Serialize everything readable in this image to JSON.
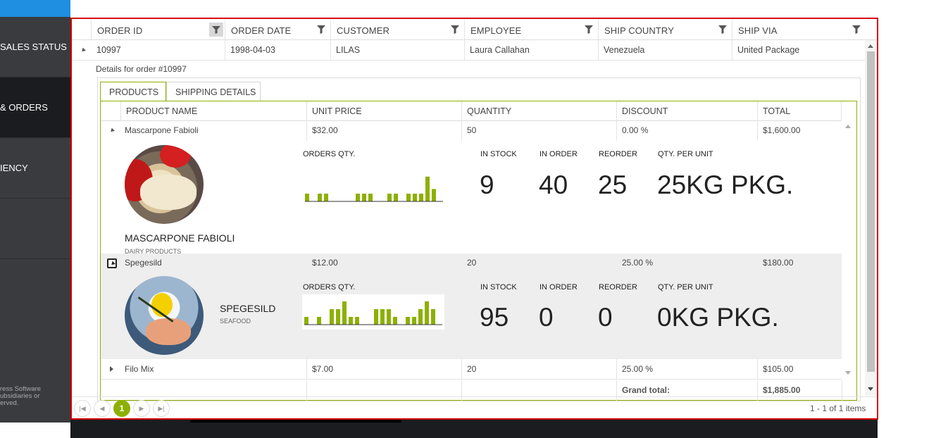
{
  "sidebar": {
    "items": [
      {
        "label": "SALES STATUS"
      },
      {
        "label": "& ORDERS"
      },
      {
        "label": "IENCY"
      }
    ],
    "footer": [
      "ress Software",
      "ubsidiaries or",
      "erved."
    ]
  },
  "grid": {
    "columns": [
      {
        "label": "ORDER ID"
      },
      {
        "label": "ORDER DATE"
      },
      {
        "label": "CUSTOMER"
      },
      {
        "label": "EMPLOYEE"
      },
      {
        "label": "SHIP COUNTRY"
      },
      {
        "label": "SHIP VIA"
      }
    ],
    "row": {
      "order_id": "10997",
      "order_date": "1998-04-03",
      "customer": "LILAS",
      "employee": "Laura Callahan",
      "ship_country": "Venezuela",
      "ship_via": "United Package"
    },
    "details_title": "Details for order #10997"
  },
  "detail": {
    "tabs": [
      {
        "label": "PRODUCTS"
      },
      {
        "label": "SHIPPING DETAILS"
      }
    ],
    "columns": [
      {
        "label": "PRODUCT NAME"
      },
      {
        "label": "UNIT PRICE"
      },
      {
        "label": "QUANTITY"
      },
      {
        "label": "DISCOUNT"
      },
      {
        "label": "TOTAL"
      }
    ],
    "stat_labels": {
      "orders_qty": "ORDERS QTY.",
      "in_stock": "IN STOCK",
      "in_order": "IN ORDER",
      "reorder": "REORDER",
      "qty_per_unit": "QTY. PER UNIT"
    },
    "products": [
      {
        "name": "Mascarpone Fabioli",
        "price": "$32.00",
        "quantity": "50",
        "discount": "0.00 %",
        "total": "$1,600.00",
        "title": "MASCARPONE FABIOLI",
        "category": "DAIRY PRODUCTS",
        "in_stock": "9",
        "in_order": "40",
        "reorder": "25",
        "qty_per_unit": "25KG PKG.",
        "orders_qty": [
          1,
          0,
          1,
          1,
          0,
          0,
          0,
          0,
          1,
          1,
          1,
          0,
          0,
          1,
          1,
          0,
          1,
          1,
          1,
          3.2,
          1.6
        ]
      },
      {
        "name": "Spegesild",
        "price": "$12.00",
        "quantity": "20",
        "discount": "25.00 %",
        "total": "$180.00",
        "title": "SPEGESILD",
        "category": "SEAFOOD",
        "in_stock": "95",
        "in_order": "0",
        "reorder": "0",
        "qty_per_unit": "0KG PKG.",
        "orders_qty": [
          1,
          0,
          1,
          0,
          2,
          2,
          3,
          1,
          1,
          0,
          0,
          2,
          2,
          2,
          1,
          0,
          1,
          1,
          2,
          3,
          2
        ]
      },
      {
        "name": "Filo Mix",
        "price": "$7.00",
        "quantity": "20",
        "discount": "25.00 %",
        "total": "$105.00"
      }
    ],
    "grand_total_label": "Grand total:",
    "grand_total": "$1,885.00"
  },
  "pager": {
    "current_page": "1",
    "info": "1 - 1 of 1 items"
  },
  "colors": {
    "accent": "#8db000",
    "frame": "#d60000",
    "sidebar": "#3a3b3f"
  }
}
